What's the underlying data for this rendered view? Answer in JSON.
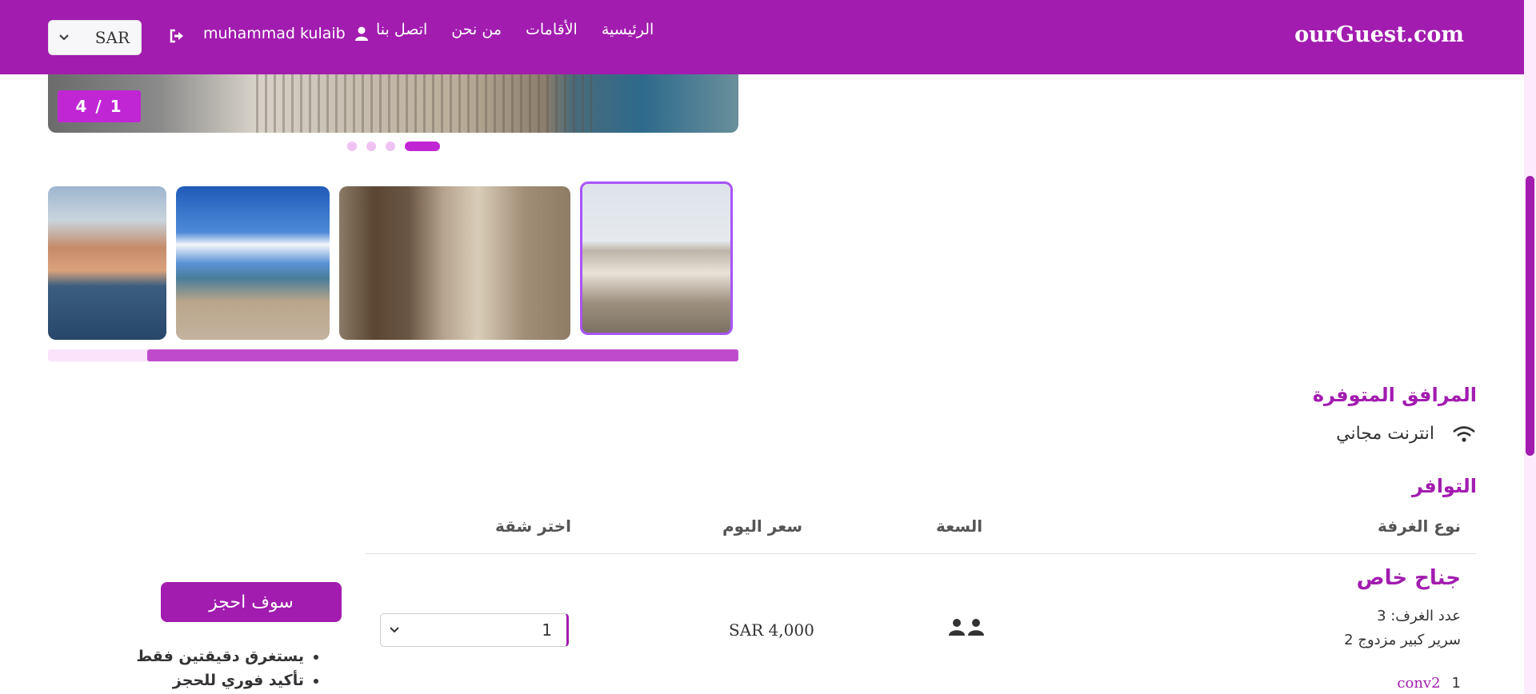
{
  "header": {
    "brand": "ourGuest.com",
    "nav": [
      {
        "label": "الرئيسية"
      },
      {
        "label": "الأقامات"
      },
      {
        "label": "من نحن"
      },
      {
        "label": "اتصل بنا"
      }
    ],
    "user_name": "muhammad kulaib",
    "currency": "SAR"
  },
  "gallery": {
    "counter": "4 / 1",
    "current_slide": 4,
    "total_slides": 4,
    "thumbnail_scroll_fraction": 0.86
  },
  "amenities": {
    "title": "المرافق المتوفرة",
    "items": [
      {
        "label": "انترنت مجاني",
        "icon": "wifi-icon"
      }
    ]
  },
  "availability": {
    "title": "التوافر",
    "columns": [
      "نوع الغرفة",
      "السعة",
      "سعر اليوم",
      "اختر شقة"
    ],
    "room": {
      "name": "جناح خاص",
      "rooms": "عدد الغرف: 3",
      "beds": "2 سرير كبير مزدوج",
      "capacity_persons": 2,
      "price": "SAR 4,000",
      "selected_qty": "1",
      "conv_num": "1",
      "conv_label": "conv2"
    },
    "book_button": "سوف احجز",
    "notes": [
      "يستغرق دقيقتين فقط",
      "تأكيد فوري للحجز"
    ]
  },
  "colors": {
    "primary": "#a21caf",
    "accent": "#c026d3"
  }
}
